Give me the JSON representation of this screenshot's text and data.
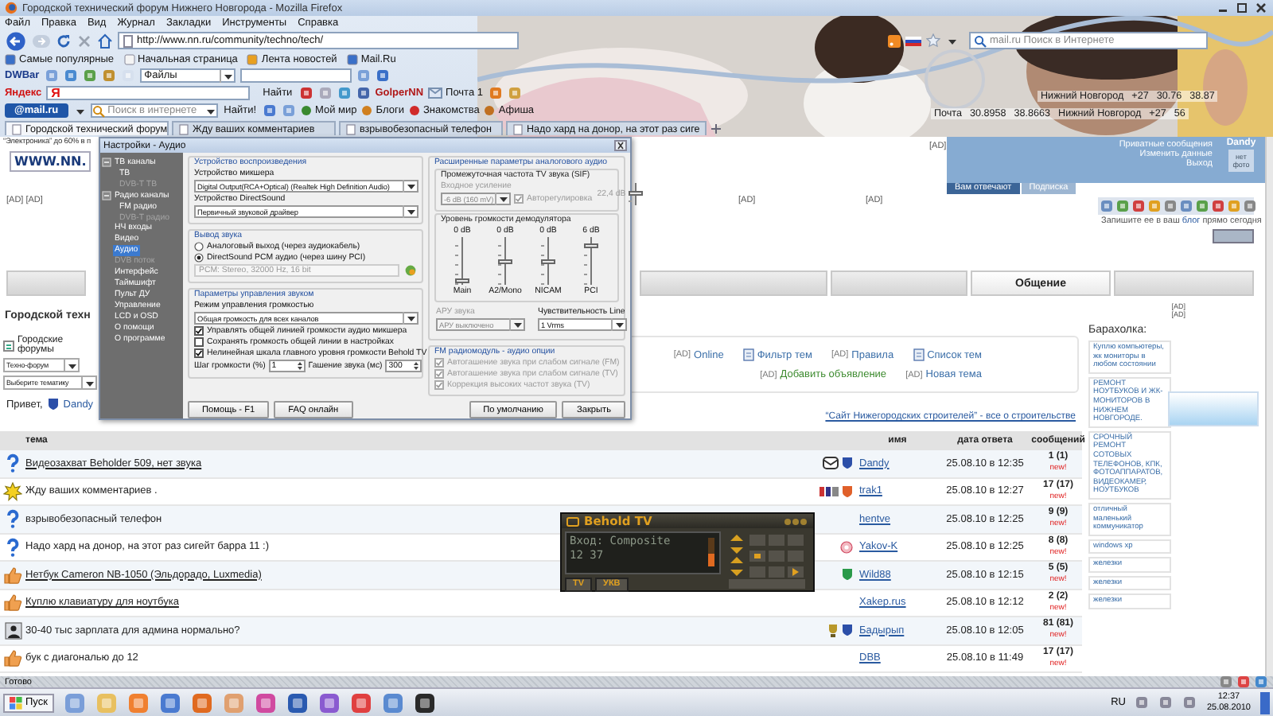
{
  "window": {
    "title": "Городской технический форум Нижнего Новгорода - Mozilla Firefox"
  },
  "menu": [
    "Файл",
    "Правка",
    "Вид",
    "Журнал",
    "Закладки",
    "Инструменты",
    "Справка"
  ],
  "address": {
    "value": "http://www.nn.ru/community/techno/tech/"
  },
  "web_search": {
    "placeholder": "mail.ru Поиск в Интернете"
  },
  "bookmarks": [
    "Самые популярные",
    "Начальная страница",
    "Лента новостей",
    "Mail.Ru"
  ],
  "dwbar": {
    "logo": "DWBar",
    "files": "Файлы"
  },
  "yandex_bar": {
    "logo": "Яндекс",
    "field_logo": "Я",
    "find": "Найти",
    "user": "GolperNN",
    "mail": "Почта 1"
  },
  "mailru_bar": {
    "logo": "@mail.ru",
    "placeholder": "Поиск в интернете",
    "find": "Найти!",
    "links": [
      "Мой мир",
      "Блоги",
      "Знакомства",
      "Афиша"
    ]
  },
  "informers": [
    [
      "Нижний Новгород",
      "+27",
      "30.76",
      "38.87"
    ],
    [
      "Почта",
      "30.8958",
      "38.8663",
      "Нижний Новгород",
      "+27",
      "56"
    ]
  ],
  "tabs": [
    {
      "label": "Городской технический форум",
      "selected": true
    },
    {
      "label": "Жду ваших комментариев",
      "selected": false
    },
    {
      "label": "взрывобезопасный телефон",
      "selected": false
    },
    {
      "label": "Надо хард на донор, на этот раз сиге",
      "selected": false
    }
  ],
  "page": {
    "promo": "“Электроника” до 60% в п",
    "logo": "WWW.NN.",
    "top_ad": "[AD]",
    "user_panel": {
      "name": "Dandy",
      "photo": "нет фото",
      "links": [
        "Приватные сообщения",
        "Изменить данные",
        "Выход"
      ],
      "tabs": [
        {
          "label": "Вам отвечают",
          "selected": true
        },
        {
          "label": "Подписка",
          "selected": false
        }
      ]
    },
    "ads": [
      "[AD] [AD]",
      "[AD]",
      "[AD]"
    ],
    "blog_promo": {
      "before": "Запишите ее в ваш ",
      "link": "блог",
      "after": " прямо сегодня"
    },
    "nav_tabs": [
      {
        "selected": false
      },
      {
        "selected": false
      },
      {
        "selected": false
      },
      {
        "label": "Общение",
        "selected": true
      },
      {
        "selected": false
      }
    ],
    "heading": "Городской техн",
    "breadcrumb": "Городские форумы",
    "forum_select": "Техно-форум",
    "topic_select": "Выберите тематику",
    "actions": [
      {
        "kind": "ad",
        "prefix": "[AD]",
        "label": "Online",
        "color": "#3a6ea8"
      },
      {
        "kind": "icon",
        "label": "Фильтр тем",
        "color": "#3a6ea8"
      },
      {
        "kind": "ad",
        "prefix": "[AD]",
        "label": "Правила",
        "color": "#3a6ea8"
      },
      {
        "kind": "icon",
        "label": "Список тем",
        "color": "#3a6ea8"
      },
      {
        "kind": "ad",
        "prefix": "[AD]",
        "label": "Добавить объявление",
        "color": "#3c8a2e"
      },
      {
        "kind": "ad",
        "prefix": "[AD]",
        "label": "Новая тема",
        "color": "#3a6ea8"
      }
    ],
    "greeting": "Привет,",
    "greeting_user": "Dandy",
    "sponsor_link": "“Сайт Нижегородских строителей” - все о строительстве",
    "columns": [
      "тема",
      "имя",
      "дата ответа",
      "сообщений"
    ],
    "topics": [
      {
        "kind": "question",
        "title": "Видеозахват Beholder 509, нет звука",
        "underlined": true,
        "badges": [
          {
            "kind": "envelope"
          },
          {
            "kind": "shield",
            "color": "#2c4fa8"
          }
        ],
        "author": "Dandy",
        "date": "25.08.10 в 12:35",
        "count": "1 (1)",
        "new": "new!"
      },
      {
        "kind": "sticky",
        "title": "Жду ваших комментариев .",
        "underlined": false,
        "badges": [
          {
            "kind": "logo"
          },
          {
            "kind": "shield",
            "color": "#e0602a"
          }
        ],
        "author": "trak1",
        "date": "25.08.10 в 12:27",
        "count": "17 (17)",
        "new": "new!"
      },
      {
        "kind": "question",
        "title": "взрывобезопасный телефон",
        "underlined": false,
        "author": "hentve",
        "date": "25.08.10 в 12:25",
        "count": "9 (9)",
        "new": "new!"
      },
      {
        "kind": "question",
        "title": "Надо хард на донор, на этот раз сигейт барра 11 :)",
        "underlined": false,
        "badges": [
          {
            "kind": "rosette"
          }
        ],
        "author": "Yakov-K",
        "date": "25.08.10 в 12:25",
        "count": "8 (8)",
        "new": "new!"
      },
      {
        "kind": "thumb",
        "title": "Нетбук Cameron NB-1050 (Эльдорадо, Luxmedia)",
        "underlined": true,
        "badges": [
          {
            "kind": "shield",
            "color": "#2a9a4a"
          }
        ],
        "author": "Wild88",
        "date": "25.08.10 в 12:15",
        "count": "5 (5)",
        "new": "new!"
      },
      {
        "kind": "thumb",
        "title": "Куплю клавиатуру для ноутбука",
        "underlined": true,
        "author": "Xakep.rus",
        "date": "25.08.10 в 12:12",
        "count": "2 (2)",
        "new": "new!"
      },
      {
        "kind": "person",
        "title": "30-40 тыс зарплата для админа нормально?",
        "underlined": false,
        "badges": [
          {
            "kind": "cup"
          },
          {
            "kind": "shield",
            "color": "#2c4fa8"
          }
        ],
        "author": "Бадырып",
        "date": "25.08.10 в 12:05",
        "count": "81 (81)",
        "new": "new!"
      },
      {
        "kind": "thumb",
        "title": "бук с диагональю до 12",
        "underlined": false,
        "author": "DBB",
        "date": "25.08.10 в 11:49",
        "count": "17 (17)",
        "new": "new!"
      }
    ],
    "side_ads": [
      "[AD]",
      "[AD]"
    ],
    "market": {
      "title": "Барахолка:",
      "ads": [
        "Куплю компьютеры, жк мониторы в любом состоянии",
        "РЕМОНТ НОУТБУКОВ И ЖК-МОНИТОРОВ В НИЖНЕМ НОВГОРОДЕ.",
        "СРОЧНЫЙ РЕМОНТ СОТОВЫХ ТЕЛЕФОНОВ, КПК, ФОТОАППАРАТОВ, ВИДЕОКАМЕР, НОУТБУКОВ",
        "отличный маленький коммуникатор",
        "windows xp",
        "железки",
        "железки",
        "железки"
      ]
    }
  },
  "dialog": {
    "title": "Настройки - Аудио",
    "nav": [
      {
        "label": "ТВ каналы",
        "selected": false,
        "disabled": false,
        "expanded": true,
        "children": [
          {
            "label": "ТВ",
            "selected": false,
            "disabled": false
          },
          {
            "label": "DVB-T ТВ",
            "selected": false,
            "disabled": true
          }
        ]
      },
      {
        "label": "Радио каналы",
        "selected": false,
        "disabled": false,
        "expanded": true,
        "children": [
          {
            "label": "FM радио",
            "selected": false,
            "disabled": false
          },
          {
            "label": "DVB-T радио",
            "selected": false,
            "disabled": true
          }
        ]
      },
      {
        "label": "НЧ входы",
        "selected": false,
        "disabled": false
      },
      {
        "label": "Видео",
        "selected": false,
        "disabled": false
      },
      {
        "label": "Аудио",
        "selected": true,
        "disabled": false
      },
      {
        "label": "DVB поток",
        "selected": false,
        "disabled": true
      },
      {
        "label": "Интерфейс",
        "selected": false,
        "disabled": false
      },
      {
        "label": "Таймшифт",
        "selected": false,
        "disabled": false
      },
      {
        "label": "Пульт ДУ",
        "selected": false,
        "disabled": false
      },
      {
        "label": "Управление",
        "selected": false,
        "disabled": false
      },
      {
        "label": "LCD и OSD",
        "selected": false,
        "disabled": false
      },
      {
        "label": "О помощи",
        "selected": false,
        "disabled": false
      },
      {
        "label": "О программе",
        "selected": false,
        "disabled": false
      }
    ],
    "playback": {
      "title": "Устройство воспроизведения",
      "mixer_label": "Устройство микшера",
      "mixer": "Digital Output(RCA+Optical) (Realtek High Definition Audio)",
      "ds_label": "Устройство DirectSound",
      "ds": "Первичный звуковой драйвер"
    },
    "output": {
      "title": "Вывод звука",
      "options": [
        {
          "label": "Аналоговый выход (через аудиокабель)",
          "selected": false
        },
        {
          "label": "DirectSound PCM аудио (через шину PCI)",
          "selected": true
        }
      ],
      "format": "PCM: Stereo, 32000 Hz, 16 bit"
    },
    "volume": {
      "title": "Параметры управления звуком",
      "mode_label": "Режим управления громкостью",
      "mode": "Общая громкость для всех каналов",
      "options": [
        {
          "label": "Управлять общей линией громкости аудио микшера",
          "checked": true
        },
        {
          "label": "Сохранять громкость общей линии в настройках",
          "checked": false
        },
        {
          "label": "Нелинейная шкала главного уровня громкости Behold TV",
          "checked": true
        }
      ],
      "step_label": "Шаг громкости (%)",
      "step": "1",
      "mute_label": "Гашение звука (мс)",
      "mute": "300"
    },
    "analog": {
      "title": "Расширенные параметры аналогового аудио",
      "sif": {
        "title": "Промежуточная частота TV звука (SIF)",
        "gain_label": "Входное усиление",
        "gain": "-6 dB (160 mV)",
        "auto": {
          "label": "Авторегулировка",
          "checked": true
        },
        "reading": "22,4 dB",
        "level": 0.5,
        "disabled": true
      },
      "demod": {
        "title": "Уровень громкости демодулятора",
        "channels": [
          {
            "name": "Main",
            "reading": "0 dB",
            "level": 0.05
          },
          {
            "name": "A2/Mono",
            "reading": "0 dB",
            "level": 0.5
          },
          {
            "name": "NICAM",
            "reading": "0 dB",
            "level": 0.5
          },
          {
            "name": "PCI",
            "reading": "6 dB",
            "level": 0.85
          }
        ]
      },
      "agc_label": "АРУ звука",
      "agc": "АРУ выключено",
      "agc_disabled": true,
      "line_label": "Чувствительность Line",
      "line": "1 Vrms"
    },
    "fm": {
      "title": "FM радиомодуль - аудио опции",
      "options": [
        {
          "label": "Автогашение звука при слабом сигнале (FM)",
          "checked": true,
          "disabled": true
        },
        {
          "label": "Автогашение звука при слабом сигнале (TV)",
          "checked": true,
          "disabled": true
        },
        {
          "label": "Коррекция высоких частот звука (TV)",
          "checked": true,
          "disabled": true
        }
      ]
    },
    "buttons": [
      "Помощь - F1",
      "FAQ онлайн",
      "По умолчанию",
      "Закрыть"
    ]
  },
  "player": {
    "title": "Behold TV",
    "input": "Вход: Composite",
    "time": "12 37",
    "buttons": [
      "TV",
      "УКВ"
    ]
  },
  "status_bar": "Готово",
  "taskbar": {
    "start": "Пуск",
    "language": "RU",
    "time": "12:37",
    "date": "25.08.2010"
  }
}
